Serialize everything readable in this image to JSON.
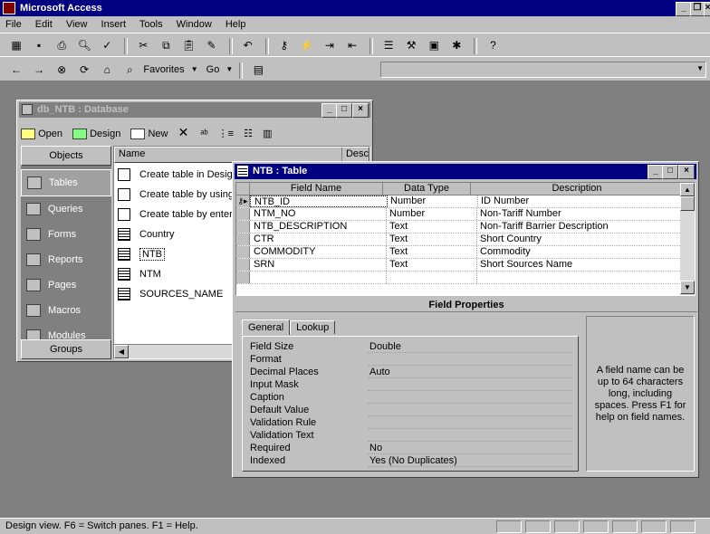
{
  "app": {
    "title": "Microsoft Access",
    "menu": [
      "File",
      "Edit",
      "View",
      "Insert",
      "Tools",
      "Window",
      "Help"
    ],
    "web_toolbar": {
      "favorites": "Favorites",
      "go": "Go"
    }
  },
  "db_window": {
    "title": "db_NTB : Database",
    "toolbar": {
      "open": "Open",
      "design": "Design",
      "new": "New"
    },
    "objects_header": "Objects",
    "groups_label": "Groups",
    "objects": [
      {
        "label": "Tables",
        "icon": "table-icon"
      },
      {
        "label": "Queries",
        "icon": "query-icon"
      },
      {
        "label": "Forms",
        "icon": "form-icon"
      },
      {
        "label": "Reports",
        "icon": "report-icon"
      },
      {
        "label": "Pages",
        "icon": "page-icon"
      },
      {
        "label": "Macros",
        "icon": "macro-icon"
      },
      {
        "label": "Modules",
        "icon": "module-icon"
      }
    ],
    "list_headers": {
      "name": "Name",
      "desc": "Desc"
    },
    "items": [
      {
        "label": "Create table in Design view",
        "kind": "wizard"
      },
      {
        "label": "Create table by using wizard",
        "kind": "wizard"
      },
      {
        "label": "Create table by entering data",
        "kind": "wizard"
      },
      {
        "label": "Country",
        "kind": "table"
      },
      {
        "label": "NTB",
        "kind": "table"
      },
      {
        "label": "NTM",
        "kind": "table"
      },
      {
        "label": "SOURCES_NAME",
        "kind": "table"
      }
    ]
  },
  "table_window": {
    "title": "NTB : Table",
    "headers": {
      "field": "Field Name",
      "type": "Data Type",
      "desc": "Description"
    },
    "rows": [
      {
        "field": "NTB_ID",
        "type": "Number",
        "desc": "ID Number"
      },
      {
        "field": "NTM_NO",
        "type": "Number",
        "desc": "Non-Tariff Number"
      },
      {
        "field": "NTB_DESCRIPTION",
        "type": "Text",
        "desc": "Non-Tariff Barrier Description"
      },
      {
        "field": "CTR",
        "type": "Text",
        "desc": "Short Country"
      },
      {
        "field": "COMMODITY",
        "type": "Text",
        "desc": "Commodity"
      },
      {
        "field": "SRN",
        "type": "Text",
        "desc": "Short Sources Name"
      }
    ],
    "field_properties_label": "Field Properties",
    "tabs": [
      "General",
      "Lookup"
    ],
    "properties": [
      {
        "label": "Field Size",
        "value": "Double"
      },
      {
        "label": "Format",
        "value": ""
      },
      {
        "label": "Decimal Places",
        "value": "Auto"
      },
      {
        "label": "Input Mask",
        "value": ""
      },
      {
        "label": "Caption",
        "value": ""
      },
      {
        "label": "Default Value",
        "value": ""
      },
      {
        "label": "Validation Rule",
        "value": ""
      },
      {
        "label": "Validation Text",
        "value": ""
      },
      {
        "label": "Required",
        "value": "No"
      },
      {
        "label": "Indexed",
        "value": "Yes (No Duplicates)"
      }
    ],
    "help_text": "A field name can be up to 64 characters long, including spaces. Press F1 for help on field names."
  },
  "status_bar": {
    "text": "Design view. F6 = Switch panes. F1 = Help."
  },
  "colors": {
    "title_active": "#000080",
    "face": "#c0c0c0",
    "workspace": "#808080"
  }
}
